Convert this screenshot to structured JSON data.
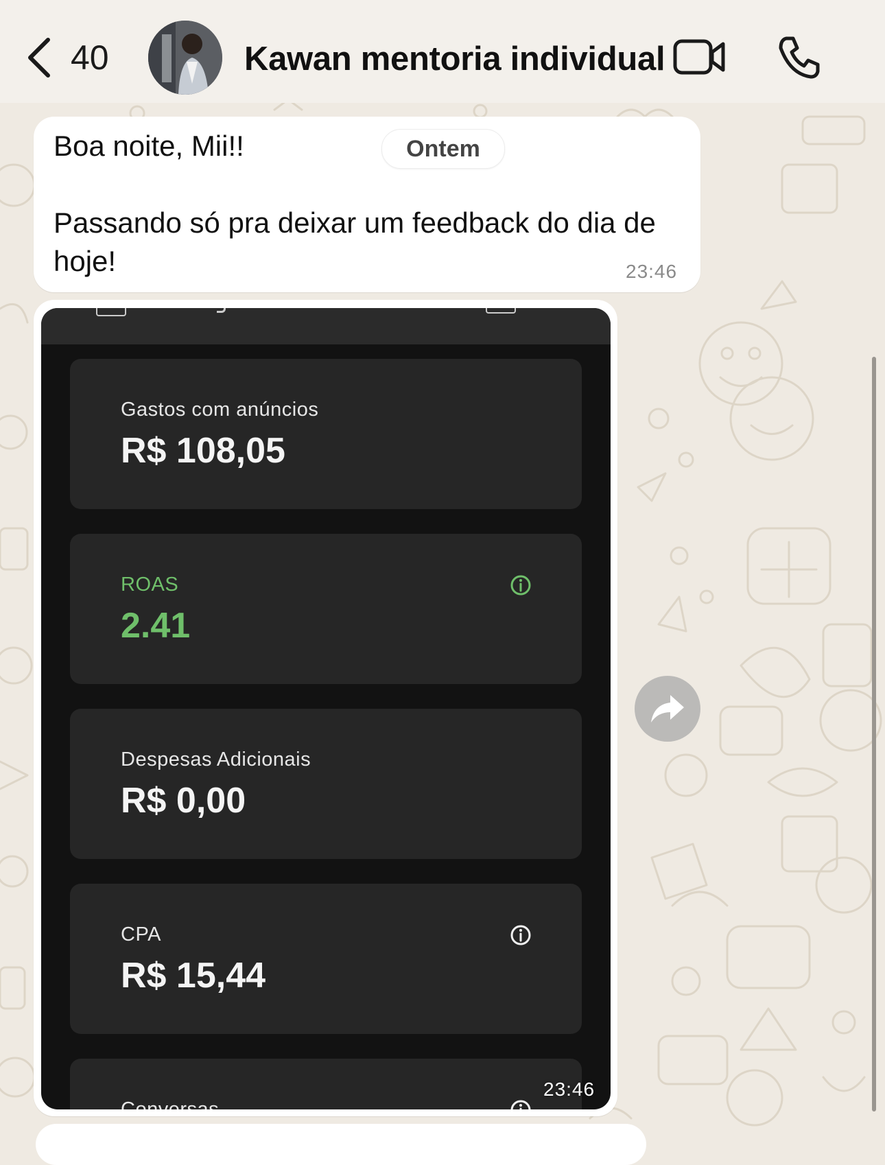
{
  "header": {
    "back_count": "40",
    "title": "Kawan mentoria individual"
  },
  "date_separator": "Ontem",
  "messages": [
    {
      "text": "Boa noite, Mii!!\n\nPassando só pra deixar um feedback do dia de hoje!",
      "time": "23:46"
    },
    {
      "type": "image",
      "time": "23:46",
      "cards": [
        {
          "label": "Gastos com anúncios",
          "value": "R$ 108,05"
        },
        {
          "label": "ROAS",
          "value": "2.41",
          "color": "#6fbf6a",
          "icon": "info-icon"
        },
        {
          "label": "Despesas Adicionais",
          "value": "R$ 0,00"
        },
        {
          "label": "CPA",
          "value": "R$ 15,44",
          "icon": "info-icon"
        },
        {
          "label": "Conversas",
          "icon": "info-icon"
        }
      ]
    }
  ],
  "icons": [
    "chevron-left-icon",
    "video-call-icon",
    "phone-call-icon",
    "forward-icon",
    "info-icon"
  ],
  "colors": {
    "header_bg": "#f3f0eb",
    "wallpaper_bg": "#efeae2",
    "accent_green": "#6fbf6a",
    "card_bg": "#262626"
  }
}
